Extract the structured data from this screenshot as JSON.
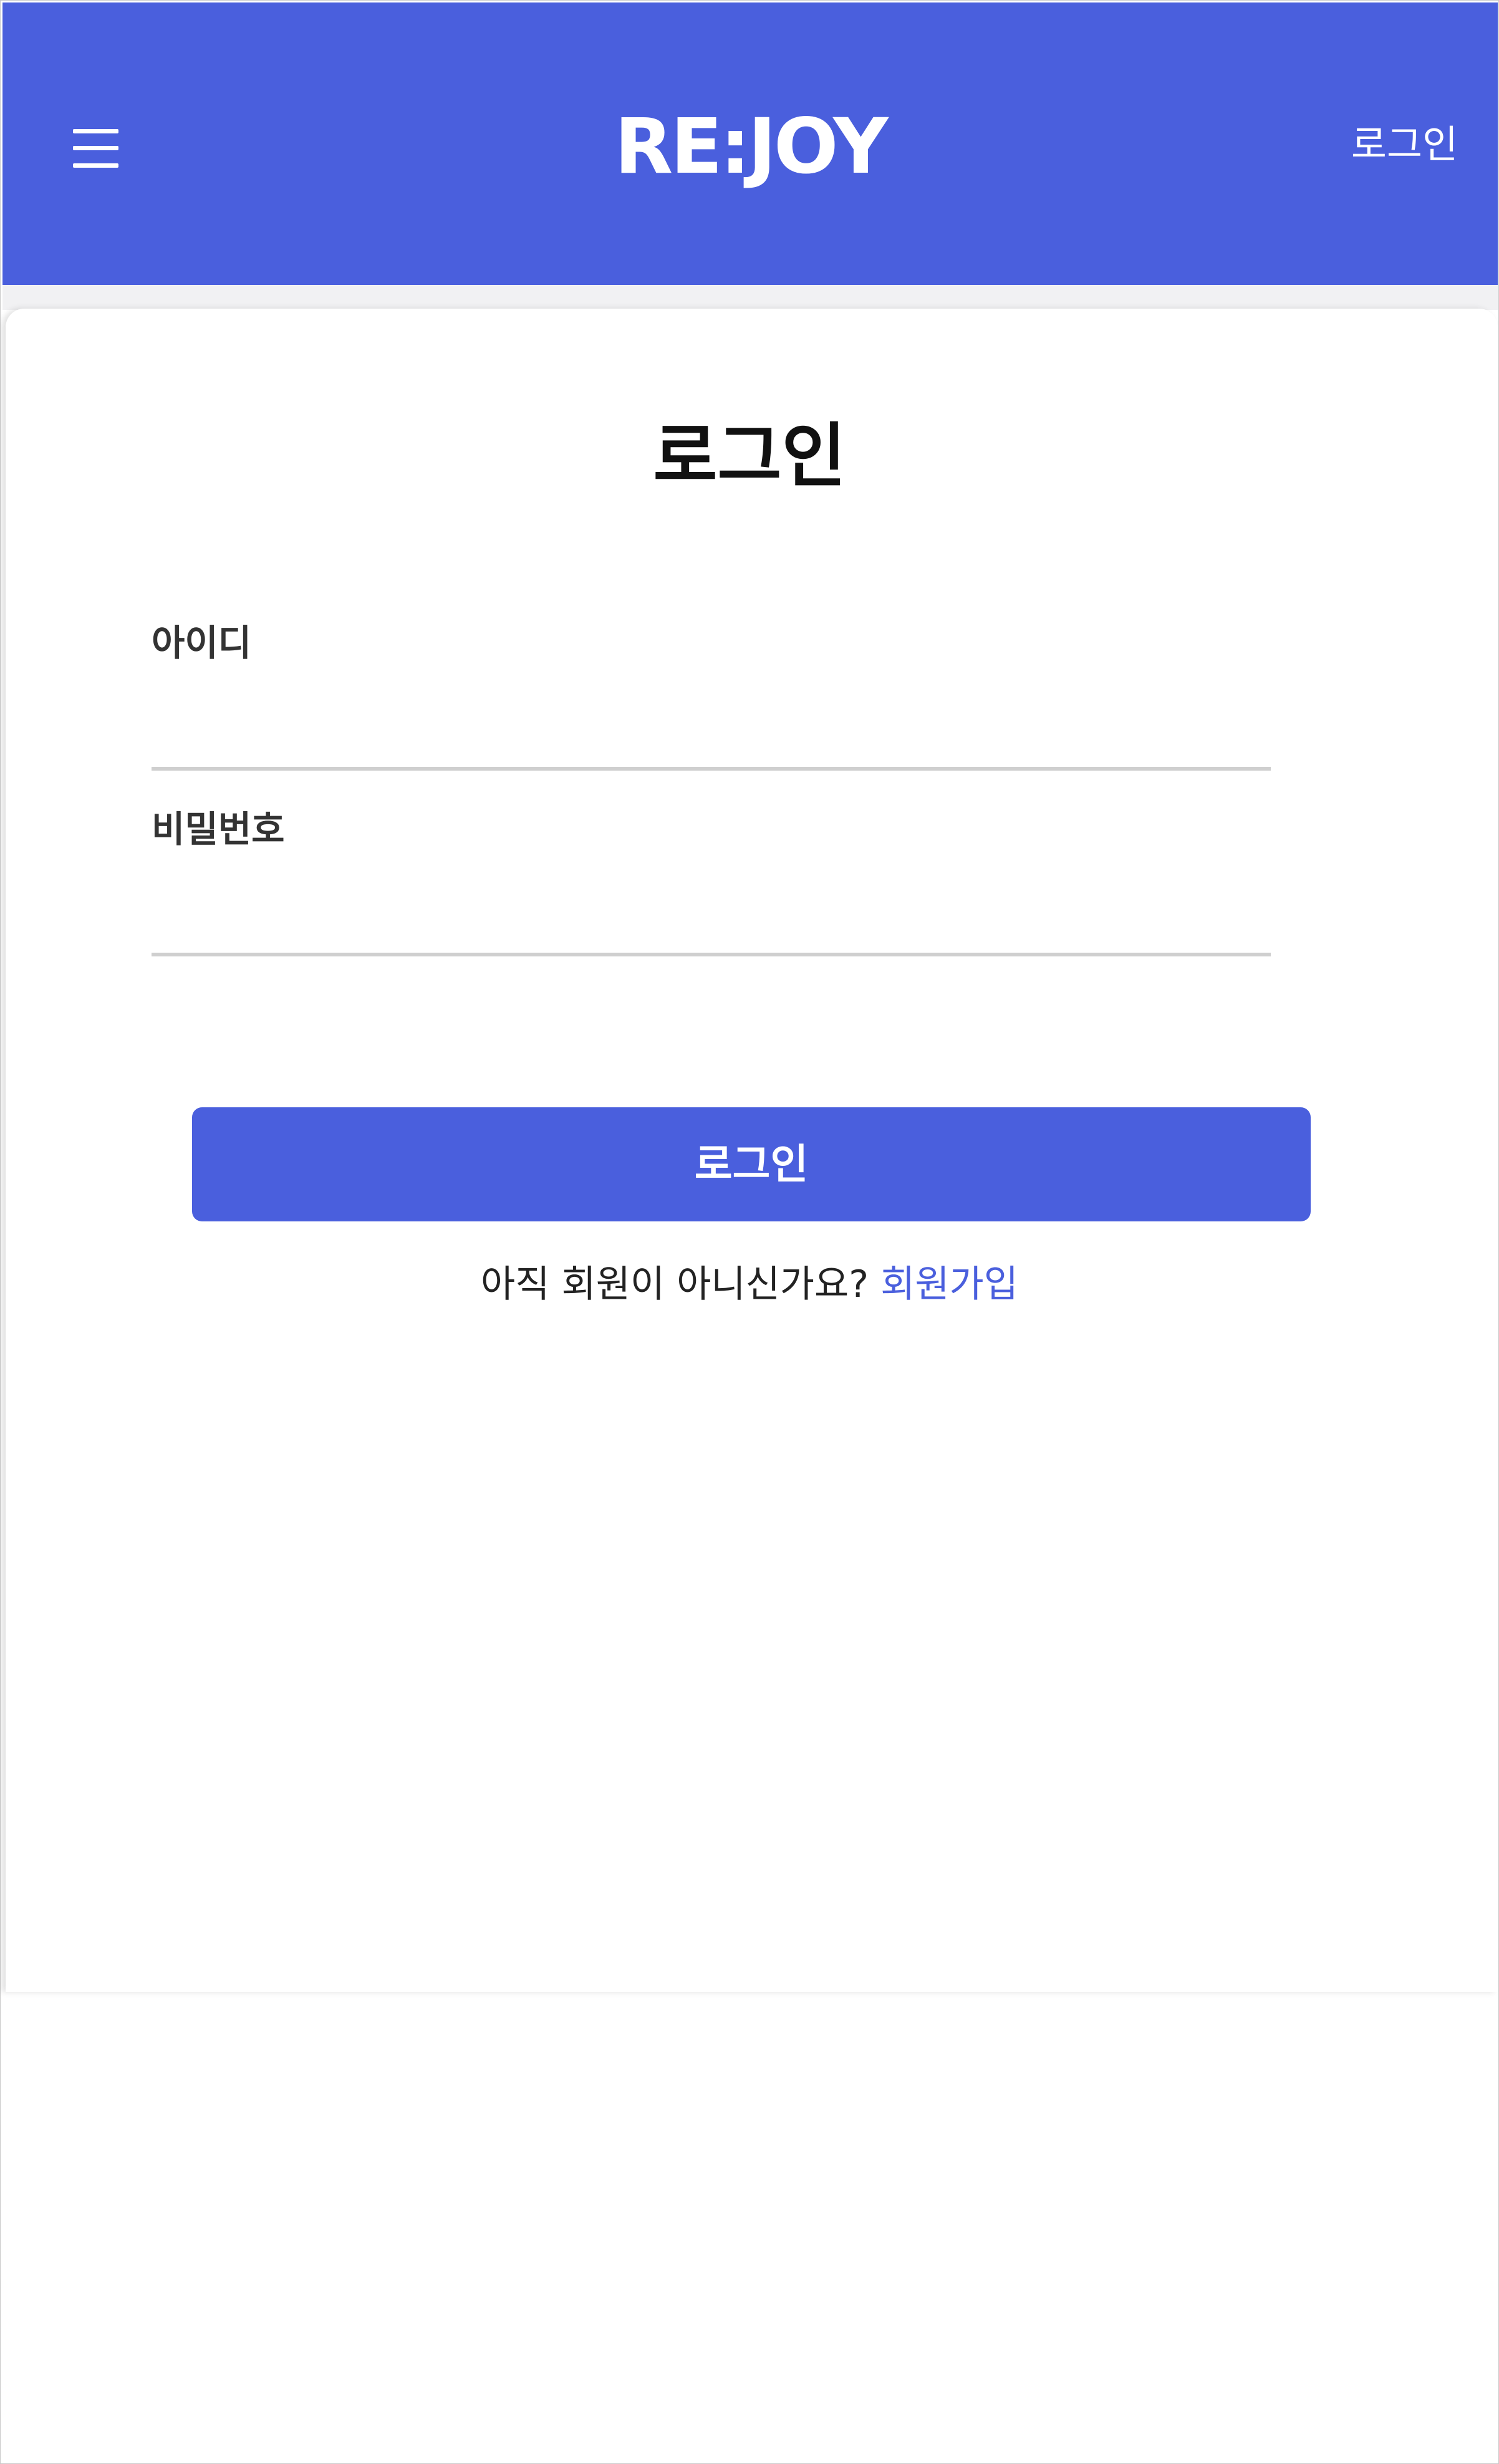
{
  "header": {
    "logo": "RE:JOY",
    "login_label": "로그인",
    "menu_icon": "hamburger-menu-icon"
  },
  "login_form": {
    "title": "로그인",
    "id_label": "아이디",
    "id_value": "",
    "password_label": "비밀번호",
    "password_value": "",
    "submit_label": "로그인",
    "signup_prompt": "아직 회원이 아니신가요?",
    "signup_link": "회원가입"
  },
  "colors": {
    "primary": "#4a5fdd",
    "background": "#ffffff",
    "band": "#f1f1f3",
    "input_underline": "#cfcfcf"
  }
}
